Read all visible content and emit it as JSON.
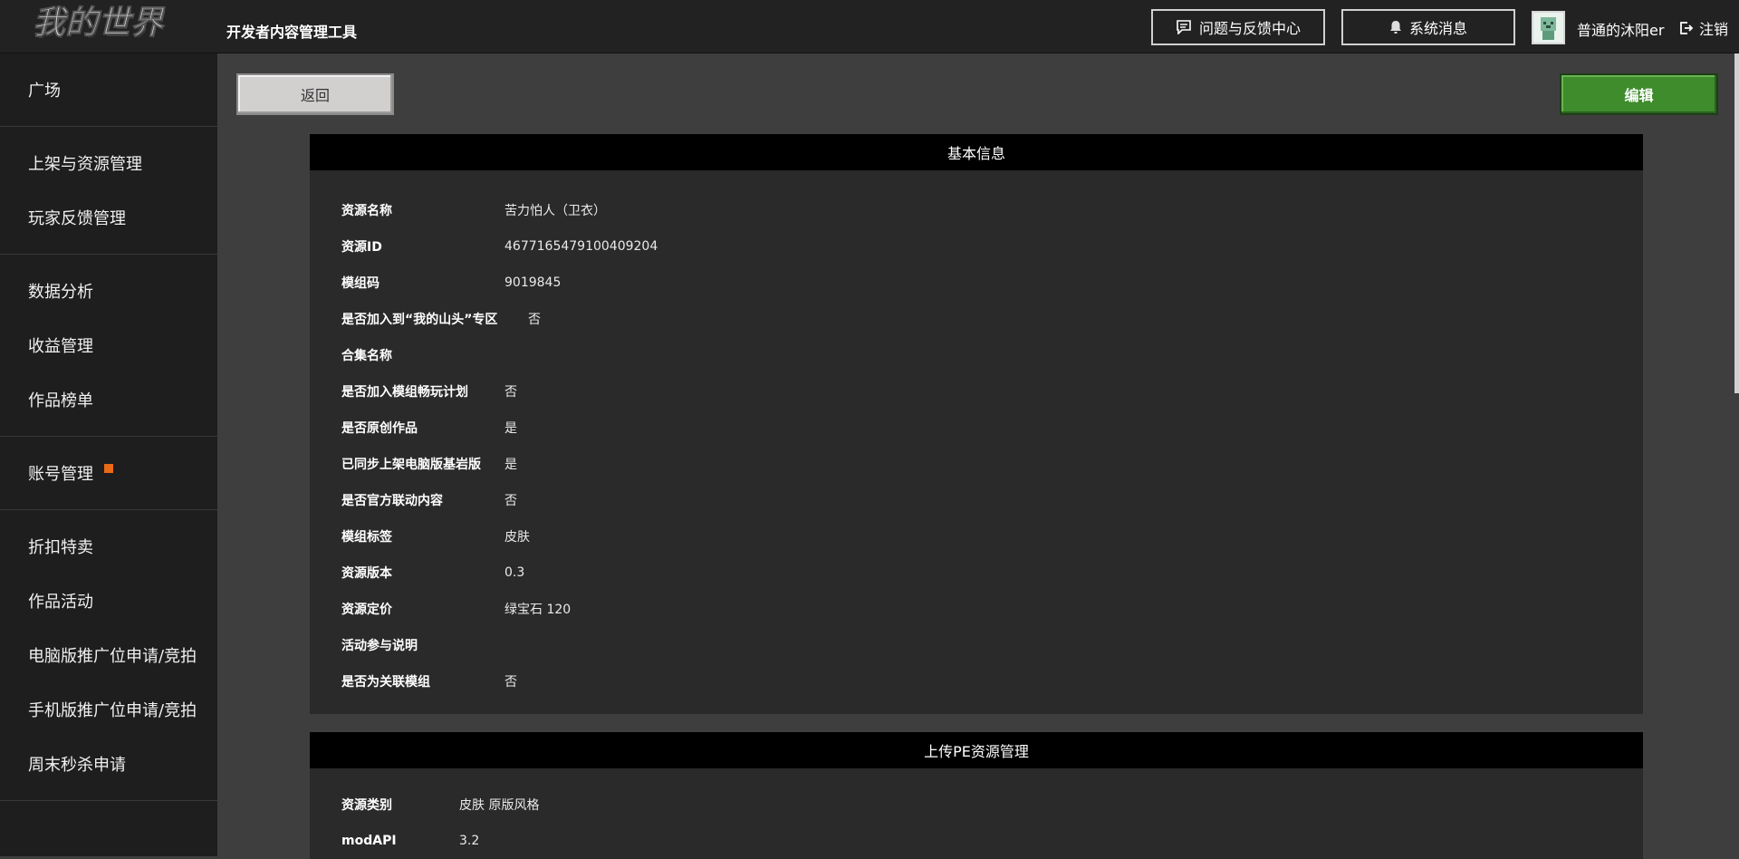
{
  "header": {
    "logo_text": "我的世界",
    "app_title": "开发者内容管理工具",
    "feedback_label": "问题与反馈中心",
    "system_label": "系统消息",
    "username": "普通的沐阳er",
    "logout_label": "注销"
  },
  "sidebar": {
    "groups": [
      [
        {
          "label": "广场"
        }
      ],
      [
        {
          "label": "上架与资源管理"
        },
        {
          "label": "玩家反馈管理"
        }
      ],
      [
        {
          "label": "数据分析"
        },
        {
          "label": "收益管理"
        },
        {
          "label": "作品榜单"
        }
      ],
      [
        {
          "label": "账号管理"
        }
      ],
      [
        {
          "label": "折扣特卖"
        },
        {
          "label": "作品活动"
        },
        {
          "label": "电脑版推广位申请/竞拍"
        },
        {
          "label": "手机版推广位申请/竞拍"
        },
        {
          "label": "周末秒杀申请"
        }
      ]
    ]
  },
  "actions": {
    "back_label": "返回",
    "edit_label": "编辑"
  },
  "basic_info": {
    "title": "基本信息",
    "rows": [
      {
        "label": "资源名称",
        "value": "苦力怕人（卫衣）"
      },
      {
        "label": "资源ID",
        "value": "4677165479100409204"
      },
      {
        "label": "模组码",
        "value": "9019845"
      },
      {
        "label": "是否加入到“我的山头”专区",
        "value": "否"
      },
      {
        "label": "合集名称",
        "value": ""
      },
      {
        "label": "是否加入模组畅玩计划",
        "value": "否"
      },
      {
        "label": "是否原创作品",
        "value": "是"
      },
      {
        "label": "已同步上架电脑版基岩版",
        "value": "是"
      },
      {
        "label": "是否官方联动内容",
        "value": "否"
      },
      {
        "label": "模组标签",
        "value": "皮肤"
      },
      {
        "label": "资源版本",
        "value": "0.3"
      },
      {
        "label": "资源定价",
        "value": "绿宝石 120"
      },
      {
        "label": "活动参与说明",
        "value": ""
      },
      {
        "label": "是否为关联模组",
        "value": "否"
      }
    ]
  },
  "pe_resource": {
    "title": "上传PE资源管理",
    "rows": [
      {
        "label": "资源类别",
        "value": "皮肤 原版风格"
      },
      {
        "label": "modAPI",
        "value": "3.2"
      }
    ]
  },
  "colors": {
    "accent_green": "#3e8c2c",
    "badge_orange": "#ea6a17",
    "header_bg": "#232222",
    "sidebar_bg": "#1f1e1e"
  }
}
